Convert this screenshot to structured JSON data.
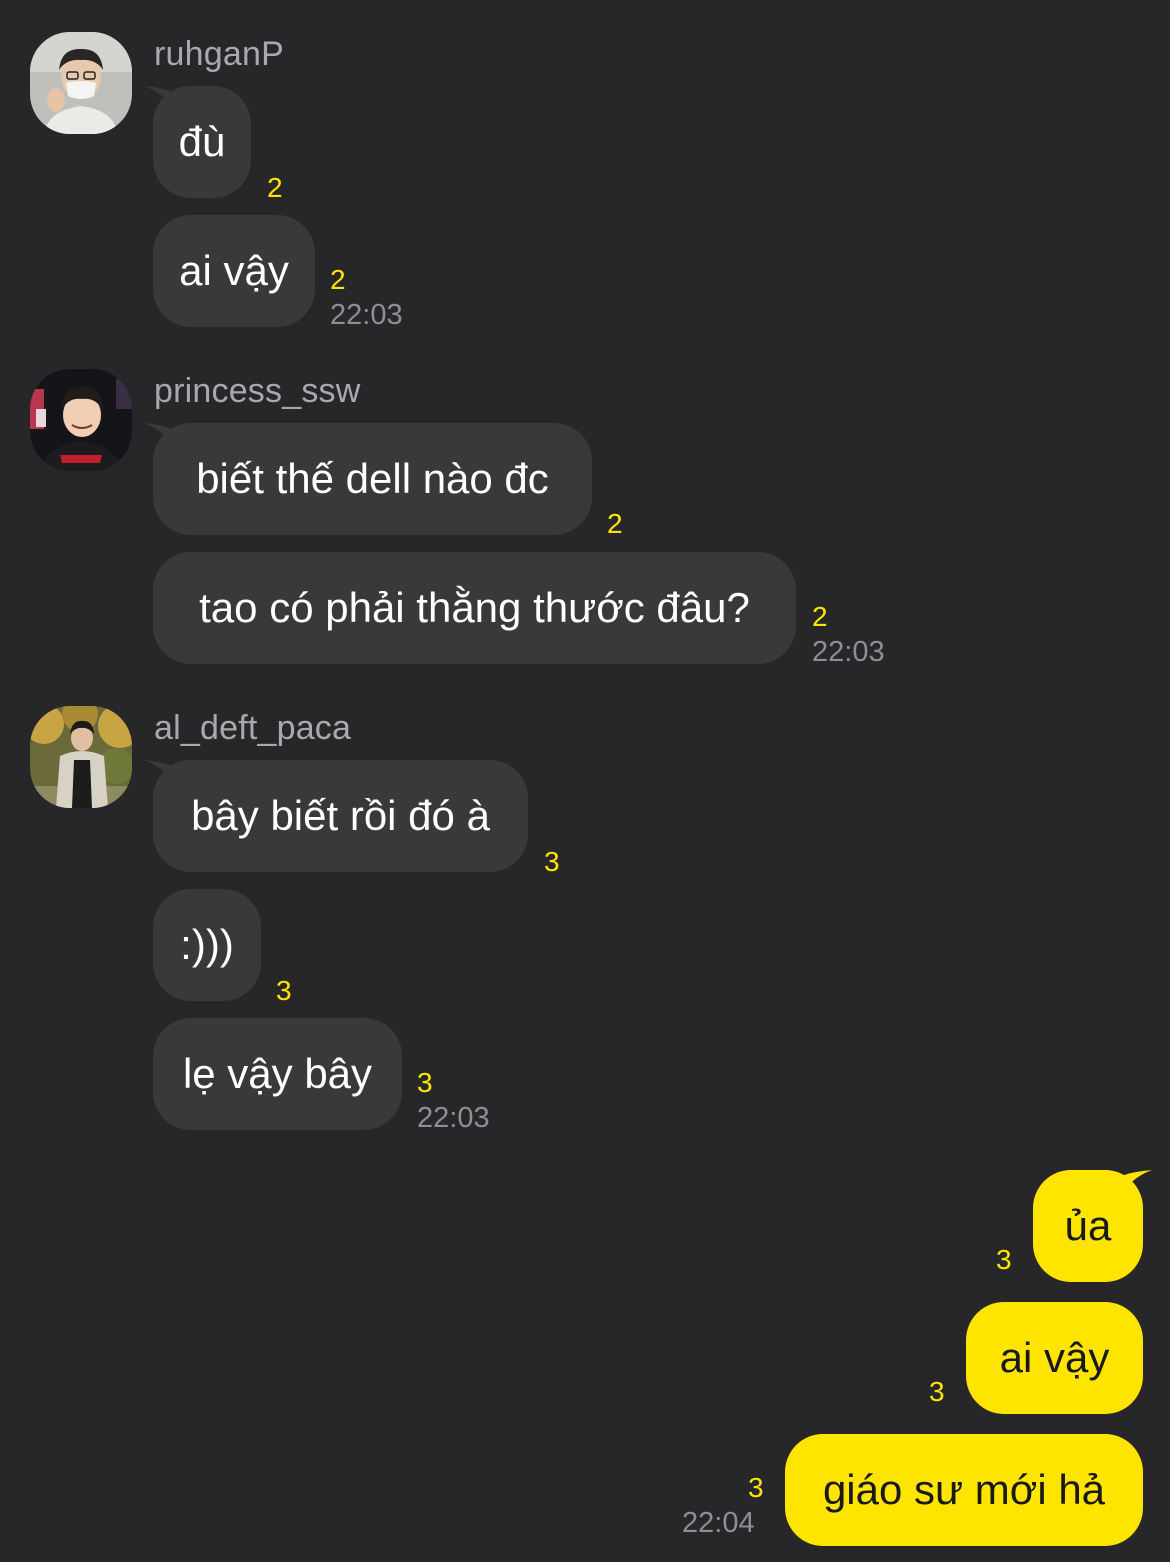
{
  "groups": [
    {
      "sender": "ruhganP",
      "messages": [
        {
          "text": "đù",
          "unread": "2"
        },
        {
          "text": "ai vậy",
          "unread": "2",
          "time": "22:03"
        }
      ]
    },
    {
      "sender": "princess_ssw",
      "messages": [
        {
          "text": "biết thế dell nào đc",
          "unread": "2"
        },
        {
          "text": "tao có phải thằng thước đâu?",
          "unread": "2",
          "time": "22:03"
        }
      ]
    },
    {
      "sender": "al_deft_paca",
      "messages": [
        {
          "text": "bây biết rồi đó à",
          "unread": "3"
        },
        {
          "text": ":)))",
          "unread": "3"
        },
        {
          "text": "lẹ vậy bây",
          "unread": "3",
          "time": "22:03"
        }
      ]
    }
  ],
  "outgoing": [
    {
      "text": "ủa",
      "unread": "3"
    },
    {
      "text": "ai vậy",
      "unread": "3"
    },
    {
      "text": "giáo sư mới hả",
      "unread": "3",
      "time": "22:04"
    }
  ],
  "colors": {
    "background": "#272729",
    "incoming_bubble": "#39393c",
    "outgoing_bubble": "#fee500",
    "unread_count": "#fee500",
    "timestamp": "#8e8e93"
  },
  "icons": [
    "avatar-ruhganP",
    "avatar-princess_ssw",
    "avatar-al_deft_paca"
  ]
}
